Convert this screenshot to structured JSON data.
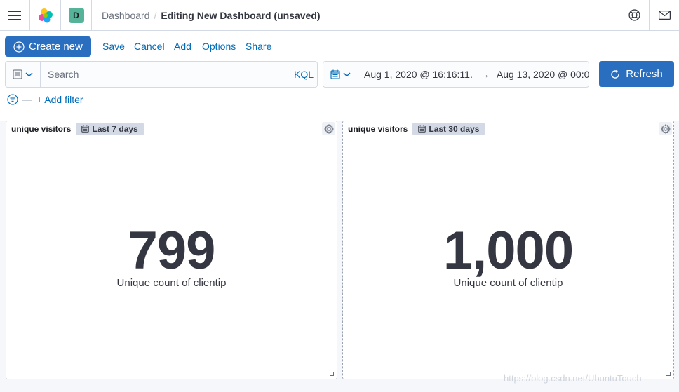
{
  "header": {
    "space_initial": "D",
    "breadcrumb": {
      "parent": "Dashboard",
      "separator": "/",
      "current": "Editing New Dashboard (unsaved)"
    }
  },
  "topnav": {
    "create_label": "Create new",
    "links": [
      "Save",
      "Cancel",
      "Add",
      "Options",
      "Share"
    ]
  },
  "query": {
    "search_placeholder": "Search",
    "language": "KQL",
    "date_start": "Aug 1, 2020 @ 16:16:11.",
    "date_end": "Aug 13, 2020 @ 00:00:0",
    "refresh_label": "Refresh",
    "add_filter_label": "+ Add filter"
  },
  "panels": [
    {
      "title": "unique visitors",
      "time_badge": "Last 7 days",
      "value": "799",
      "label": "Unique count of clientip"
    },
    {
      "title": "unique visitors",
      "time_badge": "Last 30 days",
      "value": "1,000",
      "label": "Unique count of clientip"
    }
  ],
  "colors": {
    "primary": "#2a6fbf",
    "link": "#006bb8",
    "text": "#343741",
    "border": "#d3dae6",
    "avatar": "#54b399"
  },
  "watermark": "https://blog.csdn.net/UbuntuTouch"
}
